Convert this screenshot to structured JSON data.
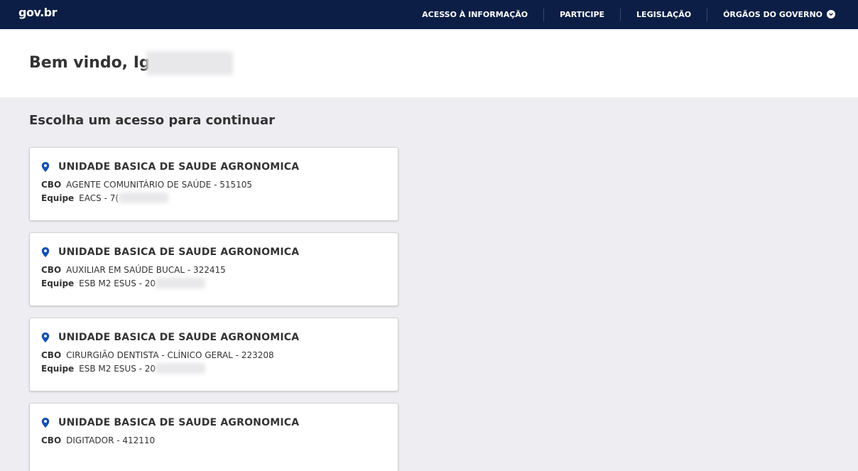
{
  "header": {
    "logo": "gov.br",
    "nav": [
      {
        "label": "ACESSO À INFORMAÇÃO"
      },
      {
        "label": "PARTICIPE"
      },
      {
        "label": "LEGISLAÇÃO"
      },
      {
        "label": "ÓRGÃOS DO GOVERNO"
      }
    ]
  },
  "welcome": {
    "text": "Bem vindo, Ig"
  },
  "section": {
    "title": "Escolha um acesso para continuar"
  },
  "cards": [
    {
      "title": "UNIDADE BASICA DE SAUDE AGRONOMICA",
      "cbo_label": "CBO",
      "cbo_value": "AGENTE COMUNITÁRIO DE SAÚDE - 515105",
      "equipe_label": "Equipe",
      "equipe_value": "EACS - 7("
    },
    {
      "title": "UNIDADE BASICA DE SAUDE AGRONOMICA",
      "cbo_label": "CBO",
      "cbo_value": "AUXILIAR EM SAÚDE BUCAL - 322415",
      "equipe_label": "Equipe",
      "equipe_value": "ESB M2 ESUS - 20"
    },
    {
      "title": "UNIDADE BASICA DE SAUDE AGRONOMICA",
      "cbo_label": "CBO",
      "cbo_value": "CIRURGIÃO DENTISTA - CLÍNICO GERAL - 223208",
      "equipe_label": "Equipe",
      "equipe_value": "ESB M2 ESUS - 20"
    },
    {
      "title": "UNIDADE BASICA DE SAUDE AGRONOMICA",
      "cbo_label": "CBO",
      "cbo_value": "DIGITADOR - 412110"
    }
  ],
  "colors": {
    "header_bg": "#0c1e45",
    "pin": "#1351b4",
    "page_bg": "#ededf2"
  },
  "icons": {
    "pin": "location-pin-icon",
    "chevron": "chevron-down-icon"
  }
}
